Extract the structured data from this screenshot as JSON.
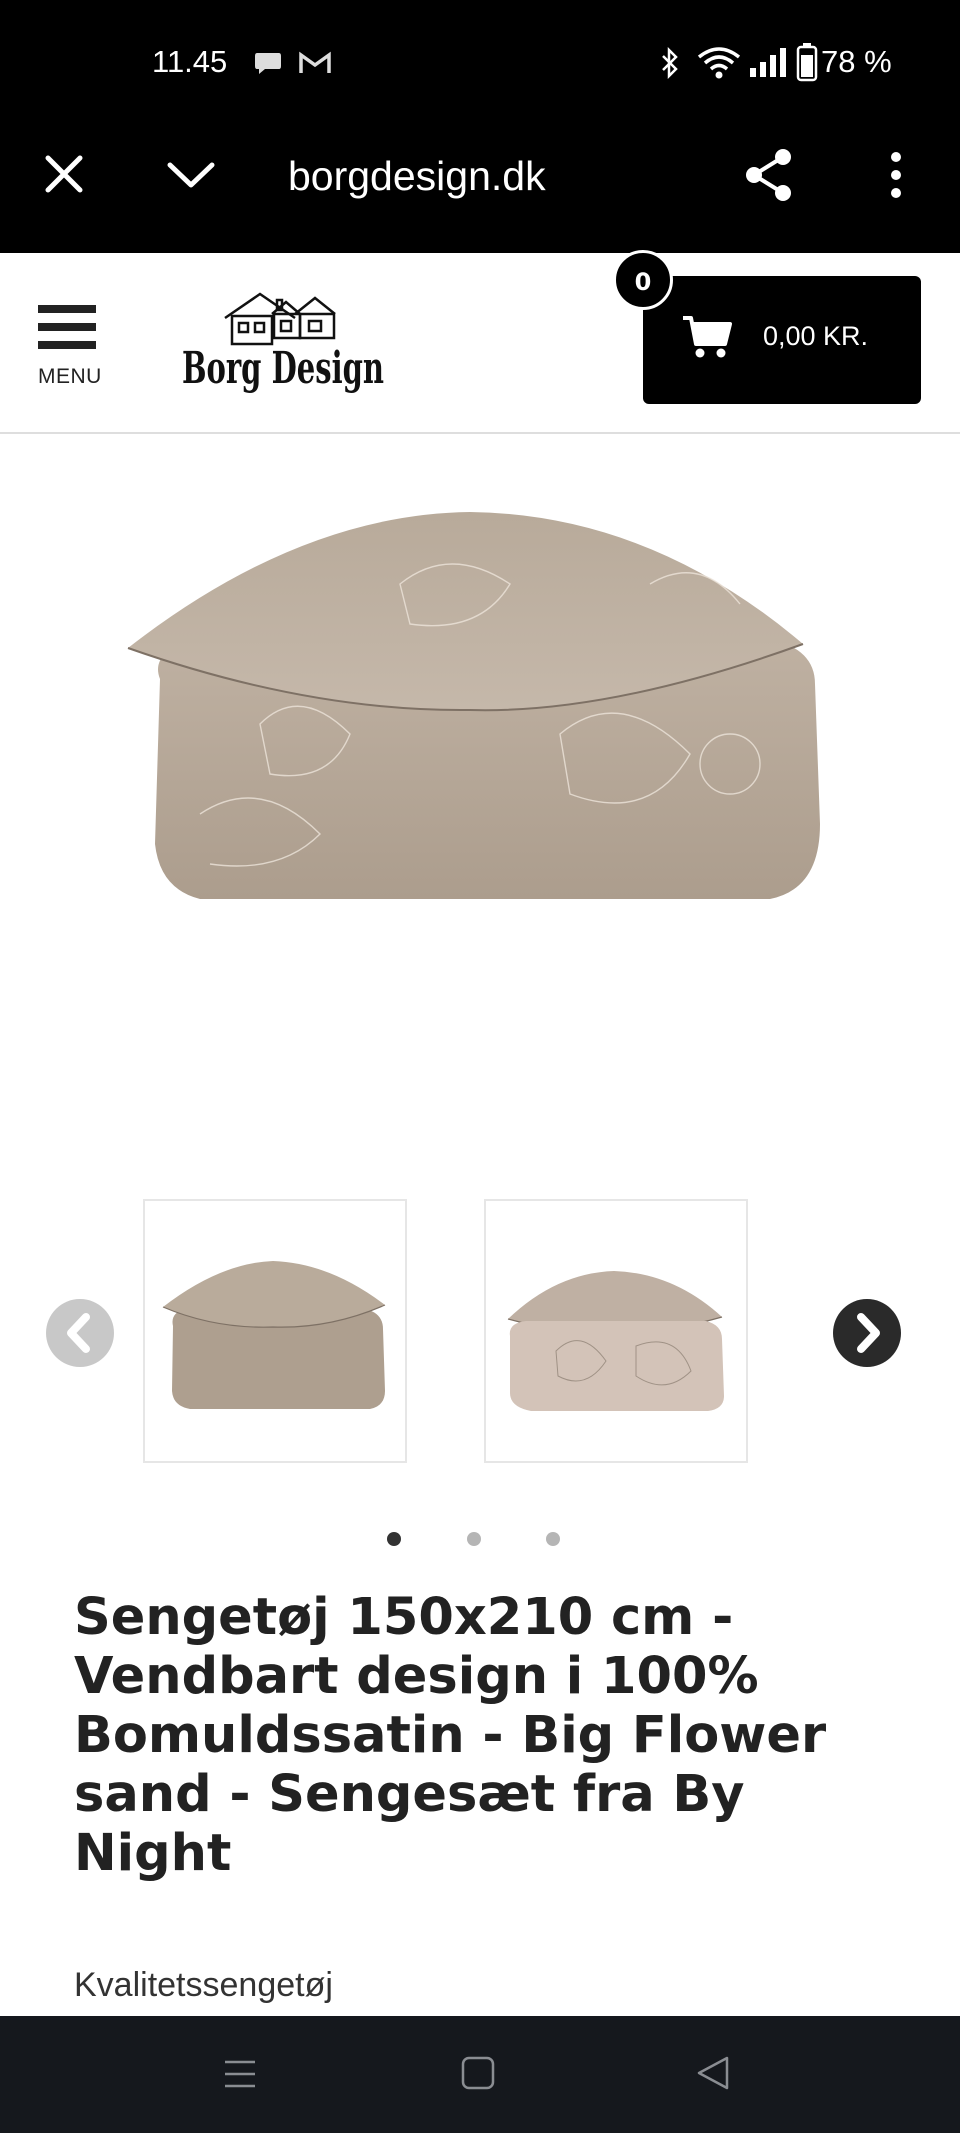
{
  "status_bar": {
    "time": "11.45",
    "battery": "78 %"
  },
  "browser": {
    "url": "borgdesign.dk"
  },
  "header": {
    "menu_label": "MENU",
    "logo_text": "Borg Design",
    "cart_count": "0",
    "cart_total": "0,00  KR."
  },
  "product": {
    "title_lines": [
      "Sengetøj 150x210 cm -",
      "Vendbart design i 100%",
      "Bomuldssatin - Big Flower",
      "sand - Sengesæt fra By",
      "Night"
    ],
    "subtitle": "Kvalitetssengetøj"
  },
  "gallery": {
    "active_dot": 1,
    "dot_count": 3
  },
  "colors": {
    "bar_bg": "#000000",
    "nav_bg": "#15181d",
    "fabric": "#b8a999"
  }
}
